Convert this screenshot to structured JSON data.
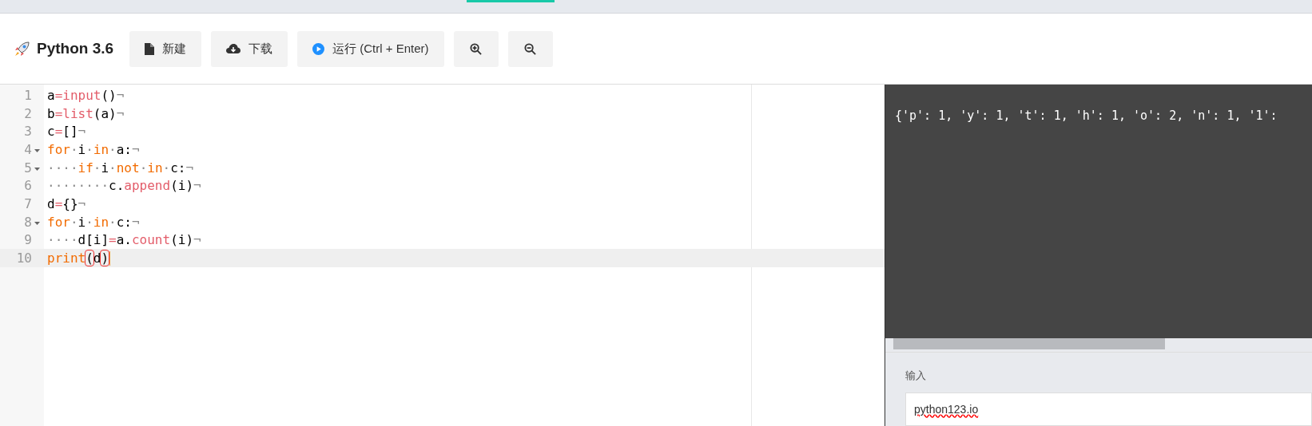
{
  "app": {
    "title": "Python 3.6"
  },
  "toolbar": [
    {
      "kind": "new",
      "label": "新建"
    },
    {
      "kind": "download",
      "label": "下载"
    },
    {
      "kind": "run",
      "label": "运行 (Ctrl + Enter)"
    },
    {
      "kind": "zoom-in"
    },
    {
      "kind": "zoom-out"
    }
  ],
  "editor": {
    "lines": [
      {
        "number": "1",
        "foldable": false,
        "active": false,
        "tokens": [
          {
            "t": "a",
            "kind": "name"
          },
          {
            "t": "=",
            "kind": "op"
          },
          {
            "t": "input",
            "kind": "func"
          },
          {
            "t": "()",
            "kind": "name"
          },
          {
            "t": "¬",
            "kind": "invisible"
          }
        ]
      },
      {
        "number": "2",
        "foldable": false,
        "active": false,
        "tokens": [
          {
            "t": "b",
            "kind": "name"
          },
          {
            "t": "=",
            "kind": "op"
          },
          {
            "t": "list",
            "kind": "func"
          },
          {
            "t": "(a)",
            "kind": "name"
          },
          {
            "t": "¬",
            "kind": "invisible"
          }
        ]
      },
      {
        "number": "3",
        "foldable": false,
        "active": false,
        "tokens": [
          {
            "t": "c",
            "kind": "name"
          },
          {
            "t": "=",
            "kind": "op"
          },
          {
            "t": "[]",
            "kind": "name"
          },
          {
            "t": "¬",
            "kind": "invisible"
          }
        ]
      },
      {
        "number": "4",
        "foldable": true,
        "active": false,
        "tokens": [
          {
            "t": "for",
            "kind": "keyword"
          },
          {
            "t": "·",
            "kind": "invisible"
          },
          {
            "t": "i",
            "kind": "name"
          },
          {
            "t": "·",
            "kind": "invisible"
          },
          {
            "t": "in",
            "kind": "keyword"
          },
          {
            "t": "·",
            "kind": "invisible"
          },
          {
            "t": "a:",
            "kind": "name"
          },
          {
            "t": "¬",
            "kind": "invisible"
          }
        ]
      },
      {
        "number": "5",
        "foldable": true,
        "active": false,
        "tokens": [
          {
            "t": "····",
            "kind": "invisible"
          },
          {
            "t": "if",
            "kind": "keyword"
          },
          {
            "t": "·",
            "kind": "invisible"
          },
          {
            "t": "i",
            "kind": "name"
          },
          {
            "t": "·",
            "kind": "invisible"
          },
          {
            "t": "not",
            "kind": "keyword"
          },
          {
            "t": "·",
            "kind": "invisible"
          },
          {
            "t": "in",
            "kind": "keyword"
          },
          {
            "t": "·",
            "kind": "invisible"
          },
          {
            "t": "c:",
            "kind": "name"
          },
          {
            "t": "¬",
            "kind": "invisible"
          }
        ]
      },
      {
        "number": "6",
        "foldable": false,
        "active": false,
        "tokens": [
          {
            "t": "········",
            "kind": "invisible"
          },
          {
            "t": "c.",
            "kind": "name"
          },
          {
            "t": "append",
            "kind": "func"
          },
          {
            "t": "(i)",
            "kind": "name"
          },
          {
            "t": "¬",
            "kind": "invisible"
          }
        ]
      },
      {
        "number": "7",
        "foldable": false,
        "active": false,
        "tokens": [
          {
            "t": "d",
            "kind": "name"
          },
          {
            "t": "=",
            "kind": "op"
          },
          {
            "t": "{}",
            "kind": "name"
          },
          {
            "t": "¬",
            "kind": "invisible"
          }
        ]
      },
      {
        "number": "8",
        "foldable": true,
        "active": false,
        "tokens": [
          {
            "t": "for",
            "kind": "keyword"
          },
          {
            "t": "·",
            "kind": "invisible"
          },
          {
            "t": "i",
            "kind": "name"
          },
          {
            "t": "·",
            "kind": "invisible"
          },
          {
            "t": "in",
            "kind": "keyword"
          },
          {
            "t": "·",
            "kind": "invisible"
          },
          {
            "t": "c:",
            "kind": "name"
          },
          {
            "t": "¬",
            "kind": "invisible"
          }
        ]
      },
      {
        "number": "9",
        "foldable": false,
        "active": false,
        "tokens": [
          {
            "t": "····",
            "kind": "invisible"
          },
          {
            "t": "d[i]",
            "kind": "name"
          },
          {
            "t": "=",
            "kind": "op"
          },
          {
            "t": "a.",
            "kind": "name"
          },
          {
            "t": "count",
            "kind": "func"
          },
          {
            "t": "(i)",
            "kind": "name"
          },
          {
            "t": "¬",
            "kind": "invisible"
          }
        ]
      },
      {
        "number": "10",
        "foldable": false,
        "active": true,
        "tokens": [
          {
            "t": "print",
            "kind": "keyword"
          },
          {
            "t": "(",
            "kind": "match"
          },
          {
            "t": "d",
            "kind": "name"
          },
          {
            "t": ")",
            "kind": "match"
          }
        ]
      }
    ]
  },
  "output": {
    "text": "{'p': 1, 'y': 1, 't': 1, 'h': 1, 'o': 2, 'n': 1, '1':"
  },
  "input": {
    "label": "输入",
    "value": "python123.io"
  }
}
